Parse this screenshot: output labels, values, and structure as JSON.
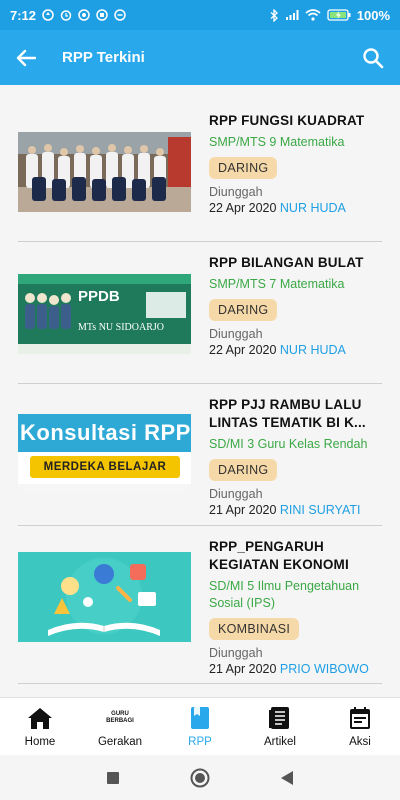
{
  "status_bar": {
    "time": "7:12",
    "battery": "100"
  },
  "app_bar": {
    "title": "RPP Terkini"
  },
  "rpp_list": [
    {
      "title": "RPP FUNGSI KUADRAT",
      "subject": "SMP/MTS 9 Matematika",
      "badge": "DARING",
      "uploaded_label": "Diunggah",
      "date": "22 Apr 2020",
      "author": "NUR HUDA"
    },
    {
      "title": "RPP BILANGAN BULAT",
      "subject": "SMP/MTS 7 Matematika",
      "badge": "DARING",
      "uploaded_label": "Diunggah",
      "date": "22 Apr 2020",
      "author": "NUR HUDA",
      "thumb_text": "PPDB",
      "thumb_school": "MTs NU SIDOARJO"
    },
    {
      "title": "RPP PJJ RAMBU LALU LINTAS TEMATIK BI K...",
      "subject": "SD/MI 3 Guru Kelas Rendah",
      "badge": "DARING",
      "uploaded_label": "Diunggah",
      "date": "21 Apr 2020",
      "author": "RINI SURYATI",
      "thumb_text": "Konsultasi RPP",
      "thumb_banner": "MERDEKA BELAJAR"
    },
    {
      "title": "RPP_PENGARUH KEGIATAN EKONOMI",
      "subject": "SD/MI 5 Ilmu Pengetahuan Sosial (IPS)",
      "badge": "KOMBINASI",
      "uploaded_label": "Diunggah",
      "date": "21 Apr 2020",
      "author": "PRIO WIBOWO"
    }
  ],
  "bottom_nav": [
    {
      "label": "Home",
      "icon": "home-icon"
    },
    {
      "label": "Gerakan",
      "icon": "guru-berbagi-logo",
      "logo_text": "GURU BERBAGI"
    },
    {
      "label": "RPP",
      "icon": "book-icon"
    },
    {
      "label": "Artikel",
      "icon": "article-icon"
    },
    {
      "label": "Aksi",
      "icon": "calendar-icon"
    }
  ],
  "colors": {
    "primary": "#29a8ec",
    "status_bar": "#1e9fe3",
    "subject_green": "#3aa845",
    "badge_bg": "#f6d9a8",
    "author_blue": "#1e9fe3"
  }
}
